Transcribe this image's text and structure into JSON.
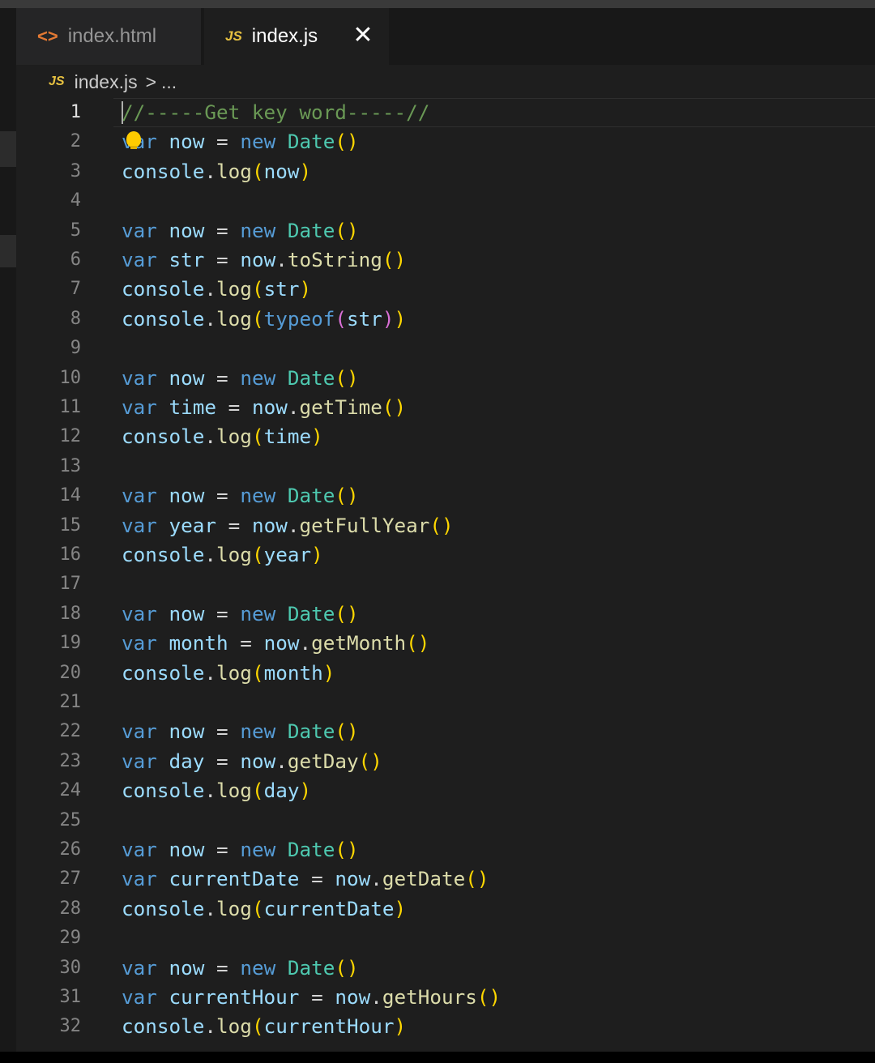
{
  "tabs": [
    {
      "label": "index.html",
      "icon": "html-file-icon",
      "icon_glyph": "<>",
      "active": false
    },
    {
      "label": "index.js",
      "icon": "js-file-icon",
      "icon_glyph": "JS",
      "active": true,
      "close_glyph": "✕"
    }
  ],
  "breadcrumb": {
    "icon_glyph": "JS",
    "file": "index.js",
    "separator": ">",
    "trail": "..."
  },
  "editor": {
    "active_line": 1,
    "lines": [
      {
        "n": 1,
        "tokens": [
          {
            "t": "//-----Get key word-----//",
            "c": "cmt"
          }
        ]
      },
      {
        "n": 2,
        "tokens": [
          {
            "t": "var",
            "c": "kw"
          },
          {
            "t": " ",
            "c": "op"
          },
          {
            "t": "now",
            "c": "var"
          },
          {
            "t": " = ",
            "c": "op"
          },
          {
            "t": "new",
            "c": "kw"
          },
          {
            "t": " ",
            "c": "op"
          },
          {
            "t": "Date",
            "c": "cls"
          },
          {
            "t": "()",
            "c": "paren"
          }
        ]
      },
      {
        "n": 3,
        "tokens": [
          {
            "t": "console",
            "c": "obj"
          },
          {
            "t": ".",
            "c": "op"
          },
          {
            "t": "log",
            "c": "fn"
          },
          {
            "t": "(",
            "c": "paren"
          },
          {
            "t": "now",
            "c": "var"
          },
          {
            "t": ")",
            "c": "paren"
          }
        ]
      },
      {
        "n": 4,
        "tokens": []
      },
      {
        "n": 5,
        "tokens": [
          {
            "t": "var",
            "c": "kw"
          },
          {
            "t": " ",
            "c": "op"
          },
          {
            "t": "now",
            "c": "var"
          },
          {
            "t": " = ",
            "c": "op"
          },
          {
            "t": "new",
            "c": "kw"
          },
          {
            "t": " ",
            "c": "op"
          },
          {
            "t": "Date",
            "c": "cls"
          },
          {
            "t": "()",
            "c": "paren"
          }
        ]
      },
      {
        "n": 6,
        "tokens": [
          {
            "t": "var",
            "c": "kw"
          },
          {
            "t": " ",
            "c": "op"
          },
          {
            "t": "str",
            "c": "var"
          },
          {
            "t": " = ",
            "c": "op"
          },
          {
            "t": "now",
            "c": "var"
          },
          {
            "t": ".",
            "c": "op"
          },
          {
            "t": "toString",
            "c": "fn"
          },
          {
            "t": "()",
            "c": "paren"
          }
        ]
      },
      {
        "n": 7,
        "tokens": [
          {
            "t": "console",
            "c": "obj"
          },
          {
            "t": ".",
            "c": "op"
          },
          {
            "t": "log",
            "c": "fn"
          },
          {
            "t": "(",
            "c": "paren"
          },
          {
            "t": "str",
            "c": "var"
          },
          {
            "t": ")",
            "c": "paren"
          }
        ]
      },
      {
        "n": 8,
        "tokens": [
          {
            "t": "console",
            "c": "obj"
          },
          {
            "t": ".",
            "c": "op"
          },
          {
            "t": "log",
            "c": "fn"
          },
          {
            "t": "(",
            "c": "paren"
          },
          {
            "t": "typeof",
            "c": "kw"
          },
          {
            "t": "(",
            "c": "paren2"
          },
          {
            "t": "str",
            "c": "var"
          },
          {
            "t": ")",
            "c": "paren2"
          },
          {
            "t": ")",
            "c": "paren"
          }
        ]
      },
      {
        "n": 9,
        "tokens": []
      },
      {
        "n": 10,
        "tokens": [
          {
            "t": "var",
            "c": "kw"
          },
          {
            "t": " ",
            "c": "op"
          },
          {
            "t": "now",
            "c": "var"
          },
          {
            "t": " = ",
            "c": "op"
          },
          {
            "t": "new",
            "c": "kw"
          },
          {
            "t": " ",
            "c": "op"
          },
          {
            "t": "Date",
            "c": "cls"
          },
          {
            "t": "()",
            "c": "paren"
          }
        ]
      },
      {
        "n": 11,
        "tokens": [
          {
            "t": "var",
            "c": "kw"
          },
          {
            "t": " ",
            "c": "op"
          },
          {
            "t": "time",
            "c": "var"
          },
          {
            "t": " = ",
            "c": "op"
          },
          {
            "t": "now",
            "c": "var"
          },
          {
            "t": ".",
            "c": "op"
          },
          {
            "t": "getTime",
            "c": "fn"
          },
          {
            "t": "()",
            "c": "paren"
          }
        ]
      },
      {
        "n": 12,
        "tokens": [
          {
            "t": "console",
            "c": "obj"
          },
          {
            "t": ".",
            "c": "op"
          },
          {
            "t": "log",
            "c": "fn"
          },
          {
            "t": "(",
            "c": "paren"
          },
          {
            "t": "time",
            "c": "var"
          },
          {
            "t": ")",
            "c": "paren"
          }
        ]
      },
      {
        "n": 13,
        "tokens": []
      },
      {
        "n": 14,
        "tokens": [
          {
            "t": "var",
            "c": "kw"
          },
          {
            "t": " ",
            "c": "op"
          },
          {
            "t": "now",
            "c": "var"
          },
          {
            "t": " = ",
            "c": "op"
          },
          {
            "t": "new",
            "c": "kw"
          },
          {
            "t": " ",
            "c": "op"
          },
          {
            "t": "Date",
            "c": "cls"
          },
          {
            "t": "()",
            "c": "paren"
          }
        ]
      },
      {
        "n": 15,
        "tokens": [
          {
            "t": "var",
            "c": "kw"
          },
          {
            "t": " ",
            "c": "op"
          },
          {
            "t": "year",
            "c": "var"
          },
          {
            "t": " = ",
            "c": "op"
          },
          {
            "t": "now",
            "c": "var"
          },
          {
            "t": ".",
            "c": "op"
          },
          {
            "t": "getFullYear",
            "c": "fn"
          },
          {
            "t": "()",
            "c": "paren"
          }
        ]
      },
      {
        "n": 16,
        "tokens": [
          {
            "t": "console",
            "c": "obj"
          },
          {
            "t": ".",
            "c": "op"
          },
          {
            "t": "log",
            "c": "fn"
          },
          {
            "t": "(",
            "c": "paren"
          },
          {
            "t": "year",
            "c": "var"
          },
          {
            "t": ")",
            "c": "paren"
          }
        ]
      },
      {
        "n": 17,
        "tokens": []
      },
      {
        "n": 18,
        "tokens": [
          {
            "t": "var",
            "c": "kw"
          },
          {
            "t": " ",
            "c": "op"
          },
          {
            "t": "now",
            "c": "var"
          },
          {
            "t": " = ",
            "c": "op"
          },
          {
            "t": "new",
            "c": "kw"
          },
          {
            "t": " ",
            "c": "op"
          },
          {
            "t": "Date",
            "c": "cls"
          },
          {
            "t": "()",
            "c": "paren"
          }
        ]
      },
      {
        "n": 19,
        "tokens": [
          {
            "t": "var",
            "c": "kw"
          },
          {
            "t": " ",
            "c": "op"
          },
          {
            "t": "month",
            "c": "var"
          },
          {
            "t": " = ",
            "c": "op"
          },
          {
            "t": "now",
            "c": "var"
          },
          {
            "t": ".",
            "c": "op"
          },
          {
            "t": "getMonth",
            "c": "fn"
          },
          {
            "t": "()",
            "c": "paren"
          }
        ]
      },
      {
        "n": 20,
        "tokens": [
          {
            "t": "console",
            "c": "obj"
          },
          {
            "t": ".",
            "c": "op"
          },
          {
            "t": "log",
            "c": "fn"
          },
          {
            "t": "(",
            "c": "paren"
          },
          {
            "t": "month",
            "c": "var"
          },
          {
            "t": ")",
            "c": "paren"
          }
        ]
      },
      {
        "n": 21,
        "tokens": []
      },
      {
        "n": 22,
        "tokens": [
          {
            "t": "var",
            "c": "kw"
          },
          {
            "t": " ",
            "c": "op"
          },
          {
            "t": "now",
            "c": "var"
          },
          {
            "t": " = ",
            "c": "op"
          },
          {
            "t": "new",
            "c": "kw"
          },
          {
            "t": " ",
            "c": "op"
          },
          {
            "t": "Date",
            "c": "cls"
          },
          {
            "t": "()",
            "c": "paren"
          }
        ]
      },
      {
        "n": 23,
        "tokens": [
          {
            "t": "var",
            "c": "kw"
          },
          {
            "t": " ",
            "c": "op"
          },
          {
            "t": "day",
            "c": "var"
          },
          {
            "t": " = ",
            "c": "op"
          },
          {
            "t": "now",
            "c": "var"
          },
          {
            "t": ".",
            "c": "op"
          },
          {
            "t": "getDay",
            "c": "fn"
          },
          {
            "t": "()",
            "c": "paren"
          }
        ]
      },
      {
        "n": 24,
        "tokens": [
          {
            "t": "console",
            "c": "obj"
          },
          {
            "t": ".",
            "c": "op"
          },
          {
            "t": "log",
            "c": "fn"
          },
          {
            "t": "(",
            "c": "paren"
          },
          {
            "t": "day",
            "c": "var"
          },
          {
            "t": ")",
            "c": "paren"
          }
        ]
      },
      {
        "n": 25,
        "tokens": []
      },
      {
        "n": 26,
        "tokens": [
          {
            "t": "var",
            "c": "kw"
          },
          {
            "t": " ",
            "c": "op"
          },
          {
            "t": "now",
            "c": "var"
          },
          {
            "t": " = ",
            "c": "op"
          },
          {
            "t": "new",
            "c": "kw"
          },
          {
            "t": " ",
            "c": "op"
          },
          {
            "t": "Date",
            "c": "cls"
          },
          {
            "t": "()",
            "c": "paren"
          }
        ]
      },
      {
        "n": 27,
        "tokens": [
          {
            "t": "var",
            "c": "kw"
          },
          {
            "t": " ",
            "c": "op"
          },
          {
            "t": "currentDate",
            "c": "var"
          },
          {
            "t": " = ",
            "c": "op"
          },
          {
            "t": "now",
            "c": "var"
          },
          {
            "t": ".",
            "c": "op"
          },
          {
            "t": "getDate",
            "c": "fn"
          },
          {
            "t": "()",
            "c": "paren"
          }
        ]
      },
      {
        "n": 28,
        "tokens": [
          {
            "t": "console",
            "c": "obj"
          },
          {
            "t": ".",
            "c": "op"
          },
          {
            "t": "log",
            "c": "fn"
          },
          {
            "t": "(",
            "c": "paren"
          },
          {
            "t": "currentDate",
            "c": "var"
          },
          {
            "t": ")",
            "c": "paren"
          }
        ]
      },
      {
        "n": 29,
        "tokens": []
      },
      {
        "n": 30,
        "tokens": [
          {
            "t": "var",
            "c": "kw"
          },
          {
            "t": " ",
            "c": "op"
          },
          {
            "t": "now",
            "c": "var"
          },
          {
            "t": " = ",
            "c": "op"
          },
          {
            "t": "new",
            "c": "kw"
          },
          {
            "t": " ",
            "c": "op"
          },
          {
            "t": "Date",
            "c": "cls"
          },
          {
            "t": "()",
            "c": "paren"
          }
        ]
      },
      {
        "n": 31,
        "tokens": [
          {
            "t": "var",
            "c": "kw"
          },
          {
            "t": " ",
            "c": "op"
          },
          {
            "t": "currentHour",
            "c": "var"
          },
          {
            "t": " = ",
            "c": "op"
          },
          {
            "t": "now",
            "c": "var"
          },
          {
            "t": ".",
            "c": "op"
          },
          {
            "t": "getHours",
            "c": "fn"
          },
          {
            "t": "()",
            "c": "paren"
          }
        ]
      },
      {
        "n": 32,
        "tokens": [
          {
            "t": "console",
            "c": "obj"
          },
          {
            "t": ".",
            "c": "op"
          },
          {
            "t": "log",
            "c": "fn"
          },
          {
            "t": "(",
            "c": "paren"
          },
          {
            "t": "currentHour",
            "c": "var"
          },
          {
            "t": ")",
            "c": "paren"
          }
        ]
      }
    ]
  },
  "colors": {
    "keyword": "#569cd6",
    "variable": "#9cdcfe",
    "function": "#dcdcaa",
    "class": "#4ec9b0",
    "comment": "#6a9955",
    "bracket": "#ffd700",
    "bracket_nested": "#da70d6",
    "editor_bg": "#1e1e1e",
    "lightbulb": "#ffcc00"
  }
}
